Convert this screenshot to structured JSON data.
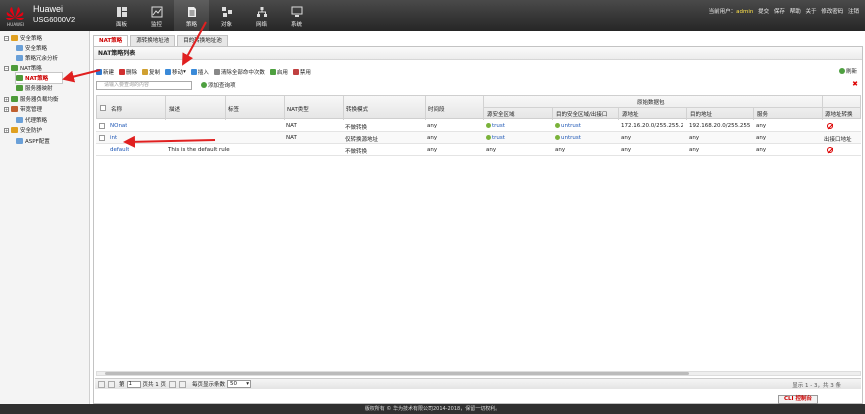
{
  "header": {
    "brand": "Huawei",
    "model": "USG6000V2",
    "logo_text": "HUAWEI",
    "nav": [
      {
        "label": "面板",
        "icon": "dashboard-icon"
      },
      {
        "label": "监控",
        "icon": "monitor-icon"
      },
      {
        "label": "策略",
        "icon": "policy-icon"
      },
      {
        "label": "对象",
        "icon": "object-icon"
      },
      {
        "label": "网络",
        "icon": "network-icon"
      },
      {
        "label": "系统",
        "icon": "system-icon"
      }
    ],
    "current_user_label": "当前用户：",
    "username": "admin",
    "links": [
      "提交",
      "保存",
      "帮助",
      "关于",
      "修改密码",
      "注销"
    ]
  },
  "sidebar": {
    "items": [
      {
        "label": "安全策略"
      },
      {
        "label": "安全策略"
      },
      {
        "label": "策略冗余分析"
      },
      {
        "label": "NAT策略"
      },
      {
        "label": "NAT策略"
      },
      {
        "label": "服务器映射"
      },
      {
        "label": "服务器负载均衡"
      },
      {
        "label": "带宽管理"
      },
      {
        "label": "代理策略"
      },
      {
        "label": "安全防护"
      },
      {
        "label": "ASPF配置"
      }
    ]
  },
  "tabs": [
    "NAT策略",
    "源转换地址池",
    "目的转换地址池"
  ],
  "panel": {
    "title": "NAT策略列表",
    "toolbar": [
      "新建",
      "删除",
      "复制",
      "移动",
      "插入",
      "清除全部命中次数",
      "启用",
      "禁用"
    ],
    "refresh": "刷新",
    "search_placeholder": "请输入要查询的内容",
    "add_query": "添加查询项"
  },
  "table": {
    "group_header": "原始数据包",
    "headers": {
      "name": "名称",
      "desc": "描述",
      "tag": "标签",
      "nat_type": "NAT类型",
      "mode": "转换模式",
      "time": "时间段",
      "src_zone": "源安全区域",
      "dst_zone": "目的安全区域/出接口",
      "src_addr": "源地址",
      "dst_addr": "目的地址",
      "service": "服务",
      "src_translate": "源地址转换"
    },
    "rows": [
      {
        "name": "NOnat",
        "desc": "",
        "tag": "",
        "nat_type": "NAT",
        "mode": "不做转换",
        "time": "any",
        "src_zone": "trust",
        "dst_zone": "untrust",
        "src_addr": "172.16.20.0/255.255.2...",
        "dst_addr": "192.168.20.0/255.255....",
        "service": "any",
        "src_translate": ""
      },
      {
        "name": "int",
        "desc": "",
        "tag": "",
        "nat_type": "NAT",
        "mode": "仅转换源地址",
        "time": "any",
        "src_zone": "trust",
        "dst_zone": "untrust",
        "src_addr": "any",
        "dst_addr": "any",
        "service": "any",
        "src_translate": "出接口地址"
      },
      {
        "name": "default",
        "desc": "This is the default rule",
        "tag": "",
        "nat_type": "",
        "mode": "不做转换",
        "time": "any",
        "src_zone": "any",
        "dst_zone": "any",
        "src_addr": "any",
        "dst_addr": "any",
        "service": "any",
        "src_translate": ""
      }
    ]
  },
  "pager": {
    "page_label": "第",
    "page_value": "1",
    "page_total": "页共 1 页",
    "per_page_label": "每页显示条数",
    "per_page_value": "50",
    "info": "显示 1 - 3，共 3 条"
  },
  "cli_button": "CLI 控制台",
  "footer": "版权所有 © 华为技术有限公司2014-2018，保留一切权利。",
  "colors": {
    "header": "#2b2b2b",
    "accent": "#cc0000",
    "link": "#1b55b5",
    "zone_dot": "#7ab23a"
  }
}
